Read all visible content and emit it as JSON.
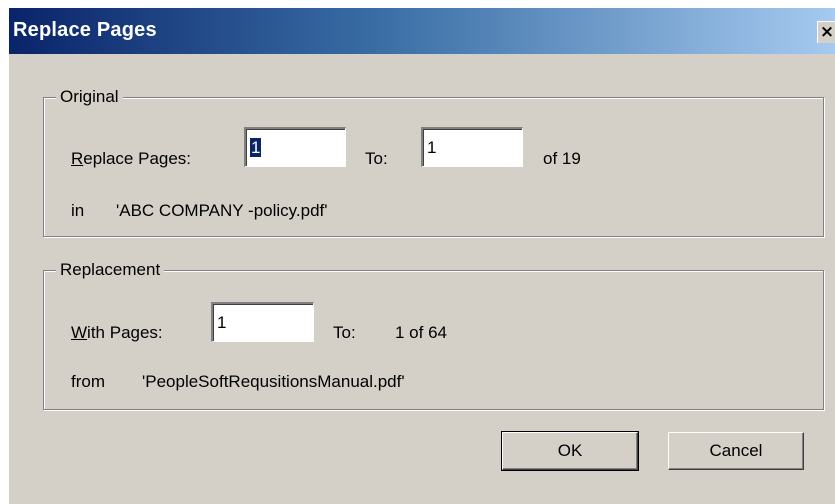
{
  "dialog": {
    "title": "Replace Pages",
    "close_glyph": "×"
  },
  "original": {
    "legend": "Original",
    "replace_label_prefix": "R",
    "replace_label_rest": "eplace Pages:",
    "from_value": "1",
    "to_label": "To:",
    "to_value": "1",
    "of_total": "of 19",
    "in_label": "in",
    "file_name": "'ABC COMPANY -policy.pdf'"
  },
  "replacement": {
    "legend": "Replacement",
    "with_label_prefix": "W",
    "with_label_rest": "ith Pages:",
    "from_value": "1",
    "to_label": "To:",
    "to_value": "1 of 64",
    "from_label": "from",
    "file_name": "'PeopleSoftRequsitionsManual.pdf'"
  },
  "buttons": {
    "ok": "OK",
    "cancel": "Cancel"
  }
}
